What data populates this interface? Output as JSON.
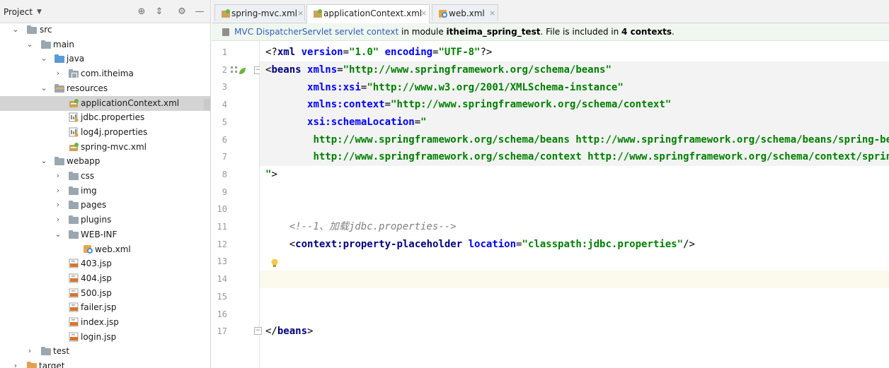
{
  "project_panel": {
    "title": "Project",
    "tree": [
      {
        "label": "src",
        "arrow": "⌄"
      },
      {
        "label": "main",
        "arrow": "⌄"
      },
      {
        "label": "java",
        "arrow": "⌄"
      },
      {
        "label": "com.itheima",
        "arrow": "›"
      },
      {
        "label": "resources",
        "arrow": "⌄"
      },
      {
        "label": "applicationContext.xml",
        "arrow": ""
      },
      {
        "label": "jdbc.properties",
        "arrow": ""
      },
      {
        "label": "log4j.properties",
        "arrow": ""
      },
      {
        "label": "spring-mvc.xml",
        "arrow": ""
      },
      {
        "label": "webapp",
        "arrow": "⌄"
      },
      {
        "label": "css",
        "arrow": "›"
      },
      {
        "label": "img",
        "arrow": "›"
      },
      {
        "label": "pages",
        "arrow": "›"
      },
      {
        "label": "plugins",
        "arrow": "›"
      },
      {
        "label": "WEB-INF",
        "arrow": "⌄"
      },
      {
        "label": "web.xml",
        "arrow": ""
      },
      {
        "label": "403.jsp",
        "arrow": ""
      },
      {
        "label": "404.jsp",
        "arrow": ""
      },
      {
        "label": "500.jsp",
        "arrow": ""
      },
      {
        "label": "failer.jsp",
        "arrow": ""
      },
      {
        "label": "index.jsp",
        "arrow": ""
      },
      {
        "label": "login.jsp",
        "arrow": ""
      },
      {
        "label": "test",
        "arrow": "›"
      },
      {
        "label": "target",
        "arrow": "›"
      }
    ]
  },
  "tabs": [
    {
      "label": "spring-mvc.xml",
      "close": "×"
    },
    {
      "label": "applicationContext.xml",
      "close": "×"
    },
    {
      "label": "web.xml",
      "close": "×"
    }
  ],
  "info_bar": {
    "link_text": "MVC DispatcherServlet servlet context",
    "text_mid": " in module ",
    "module": "itheima_spring_test",
    "text_after": ". File is included in ",
    "contexts": "4 contexts",
    "text_end": "."
  },
  "line_numbers": [
    "1",
    "2",
    "3",
    "4",
    "5",
    "6",
    "7",
    "8",
    "9",
    "10",
    "11",
    "12",
    "13",
    "14",
    "15",
    "16",
    "17"
  ],
  "code": {
    "l1": {
      "p1": "<?",
      "tag": "xml",
      "a1": " version",
      "eq1": "=",
      "v1": "\"1.0\"",
      "a2": " encoding",
      "eq2": "=",
      "v2": "\"UTF-8\"",
      "p2": "?>"
    },
    "l2": {
      "p1": "<",
      "tag": "beans",
      "a1": " xmlns",
      "eq1": "=",
      "v1": "\"http://www.springframework.org/schema/beans\""
    },
    "l3": {
      "indent": "       ",
      "a1": "xmlns:xsi",
      "eq1": "=",
      "v1": "\"http://www.w3.org/2001/XMLSchema-instance\""
    },
    "l4": {
      "indent": "       ",
      "a1": "xmlns:context",
      "eq1": "=",
      "v1": "\"http://www.springframework.org/schema/context\""
    },
    "l5": {
      "indent": "       ",
      "a1": "xsi:schemaLocation",
      "eq1": "=",
      "v1": "\""
    },
    "l6": {
      "indent": "        ",
      "v1": "http://www.springframework.org/schema/beans http://www.springframework.org/schema/beans/spring-beans.xsd"
    },
    "l7": {
      "indent": "        ",
      "v1": "http://www.springframework.org/schema/context http://www.springframework.org/schema/context/spring-context.xsd"
    },
    "l8": {
      "v1": "\"",
      "p1": ">"
    },
    "l11": {
      "indent": "    ",
      "cmt": "<!--1、加载jdbc.properties-->"
    },
    "l12": {
      "indent": "    ",
      "p1": "<",
      "tag": "context:property-placeholder",
      "a1": " location",
      "eq1": "=",
      "v1": "\"classpath:jdbc.properties\"",
      "p2": "/>"
    },
    "l17": {
      "p1": "</",
      "tag": "beans",
      "p2": ">"
    }
  }
}
